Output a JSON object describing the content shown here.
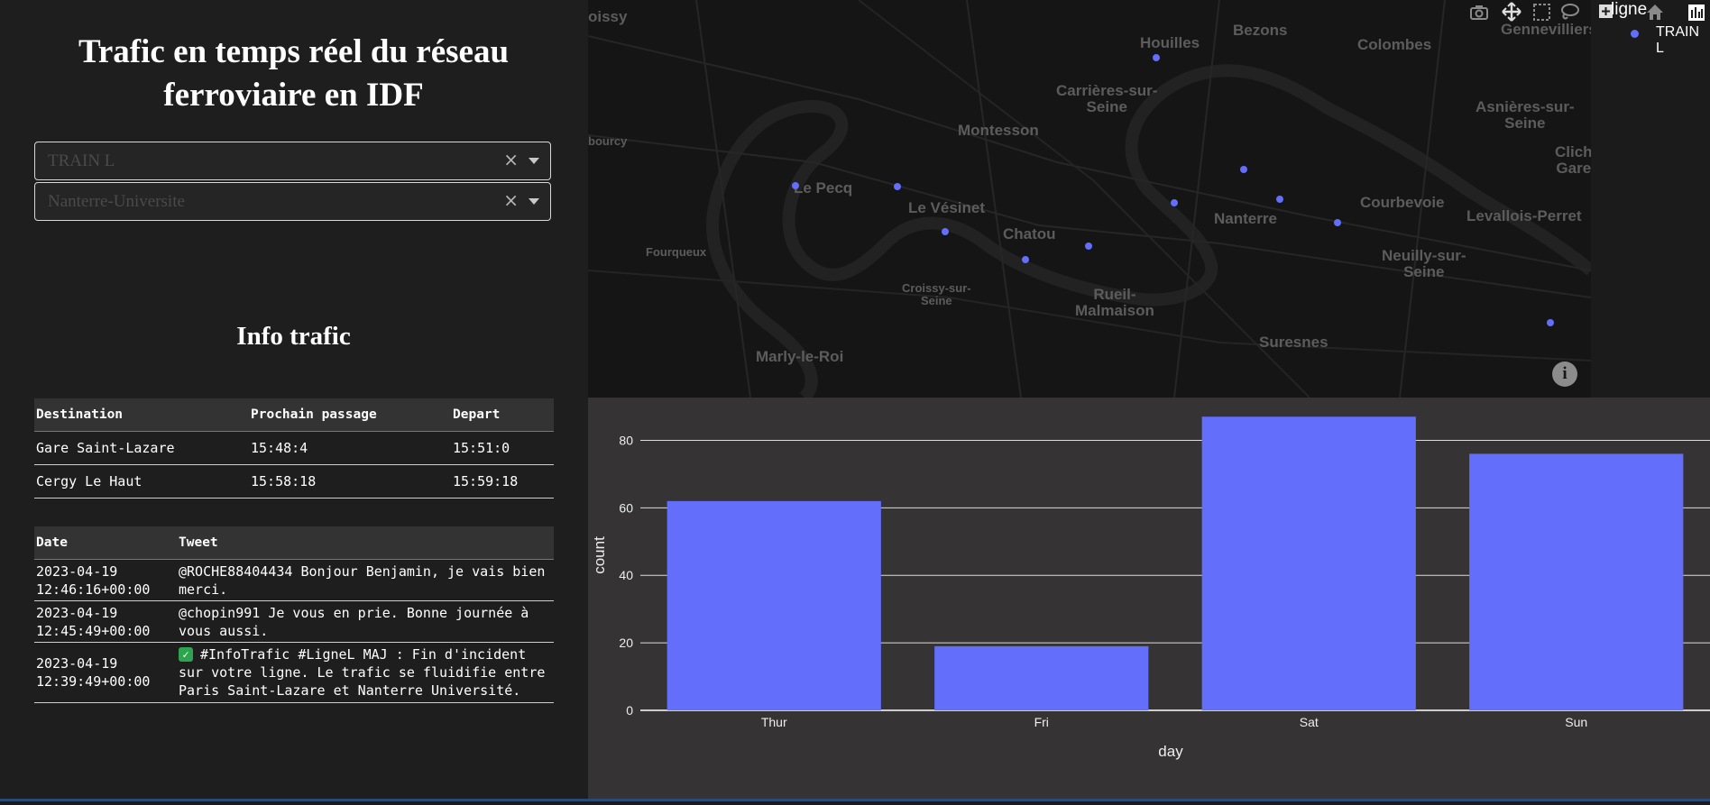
{
  "header": {
    "title": "Trafic en temps réel du réseau ferroviaire en IDF"
  },
  "filters": {
    "line": {
      "value": "TRAIN L",
      "clear": "×"
    },
    "station": {
      "value": "Nanterre-Universite",
      "clear": "×"
    }
  },
  "info_trafic": {
    "title": "Info trafic",
    "passages": {
      "headers": [
        "Destination",
        "Prochain passage",
        "Depart"
      ],
      "rows": [
        [
          "Gare Saint-Lazare",
          "15:48:4",
          "15:51:0"
        ],
        [
          "Cergy Le Haut",
          "15:58:18",
          "15:59:18"
        ]
      ]
    },
    "tweets": {
      "headers": [
        "Date",
        "Tweet"
      ],
      "rows": [
        [
          "2023-04-19\n12:46:16+00:00",
          "@ROCHE88404434 Bonjour Benjamin, je vais bien merci."
        ],
        [
          "2023-04-19\n12:45:49+00:00",
          "@chopin991 Je vous en prie. Bonne journée à vous aussi."
        ],
        [
          "2023-04-19\n12:39:49+00:00",
          "#InfoTrafic #LigneL MAJ : Fin d'incident sur votre ligne. Le trafic se fluidifie entre Paris Saint-Lazare et Nanterre Université."
        ]
      ]
    }
  },
  "map": {
    "labels": {
      "oissy": "oissy",
      "houilles": "Houilles",
      "bezons": "Bezons",
      "colombes": "Colombes",
      "gennevilliers": "Gennevilliers",
      "carrieres": "Carrières-sur-\nSeine",
      "asnieres": "Asnières-sur-\nSeine",
      "bourcy": "bourcy",
      "montesson": "Montesson",
      "clichy": "Clich\nGare",
      "le_pecq": "Le Pecq",
      "le_vesinet": "Le Vésinet",
      "nanterre": "Nanterre",
      "courbevoie": "Courbevoie",
      "levallois": "Levallois-Perret",
      "chatou": "Chatou",
      "fourqueux": "Fourqueux",
      "neuilly": "Neuilly-sur-\nSeine",
      "croissy": "Croissy-sur-\nSeine",
      "rueil": "Rueil-\nMalmaison",
      "suresnes": "Suresnes",
      "marly": "Marly-le-Roi"
    },
    "info_icon": "i",
    "legend": {
      "title": "ligne",
      "entry": "TRAIN L",
      "color": "#636efa"
    },
    "modebar_icons": [
      "camera-icon",
      "pan-icon",
      "box-select-icon",
      "lasso-icon",
      "plus-icon",
      "home-icon",
      "plotly-logo-icon"
    ]
  },
  "chart_data": {
    "type": "bar",
    "categories": [
      "Thur",
      "Fri",
      "Sat",
      "Sun"
    ],
    "values": [
      62,
      19,
      87,
      76
    ],
    "xlabel": "day",
    "ylabel": "count",
    "ylim": [
      0,
      90
    ],
    "yticks": [
      0,
      20,
      40,
      60,
      80
    ],
    "color": "#636efa",
    "grid": true
  }
}
